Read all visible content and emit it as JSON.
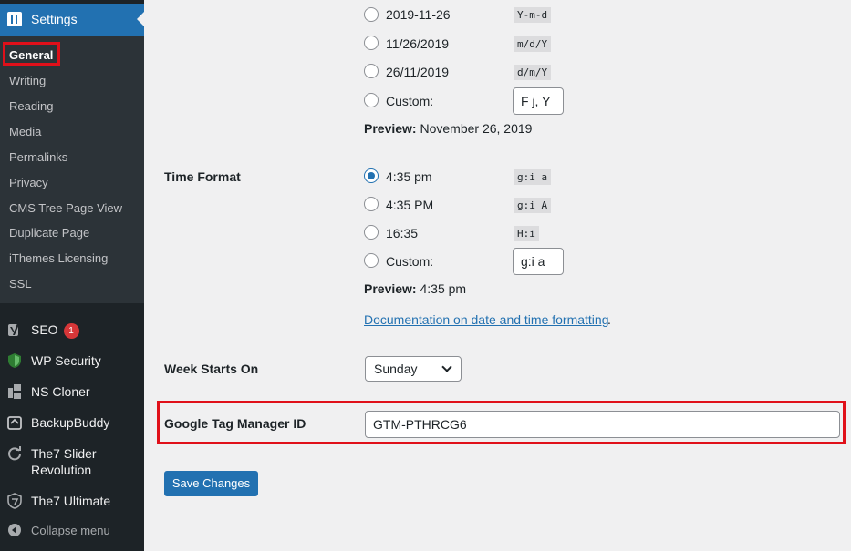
{
  "sidebar": {
    "settings_label": "Settings",
    "submenu": [
      "General",
      "Writing",
      "Reading",
      "Media",
      "Permalinks",
      "Privacy",
      "CMS Tree Page View",
      "Duplicate Page",
      "iThemes Licensing",
      "SSL"
    ],
    "menu": [
      {
        "label": "SEO",
        "badge": "1",
        "icon": "yoast-icon"
      },
      {
        "label": "WP Security",
        "icon": "shield-icon"
      },
      {
        "label": "NS Cloner",
        "icon": "windows-icon"
      },
      {
        "label": "BackupBuddy",
        "icon": "backup-icon"
      },
      {
        "label": "The7 Slider Revolution",
        "line1": "The7 Slider",
        "line2": "Revolution",
        "icon": "refresh-icon"
      },
      {
        "label": "The7 Ultimate",
        "icon": "the7-shield-icon"
      }
    ],
    "collapse_label": "Collapse menu"
  },
  "date_format": {
    "options": [
      {
        "label": "2019-11-26",
        "code": "Y-m-d"
      },
      {
        "label": "11/26/2019",
        "code": "m/d/Y"
      },
      {
        "label": "26/11/2019",
        "code": "d/m/Y"
      },
      {
        "label": "Custom:",
        "value": "F j, Y"
      }
    ],
    "preview_label": "Preview:",
    "preview_value": "November 26, 2019"
  },
  "time_format": {
    "label": "Time Format",
    "options": [
      {
        "label": "4:35 pm",
        "code": "g:i a",
        "checked": true
      },
      {
        "label": "4:35 PM",
        "code": "g:i A"
      },
      {
        "label": "16:35",
        "code": "H:i"
      },
      {
        "label": "Custom:",
        "value": "g:i a"
      }
    ],
    "preview_label": "Preview:",
    "preview_value": "4:35 pm",
    "doc_link": "Documentation on date and time formatting",
    "doc_period": "."
  },
  "week": {
    "label": "Week Starts On",
    "value": "Sunday"
  },
  "gtm": {
    "label": "Google Tag Manager ID",
    "value": "GTM-PTHRCG6"
  },
  "save_label": "Save Changes",
  "colors": {
    "sidebar_bg": "#1d2327",
    "accent": "#2271b1",
    "highlight": "#e0101a"
  }
}
